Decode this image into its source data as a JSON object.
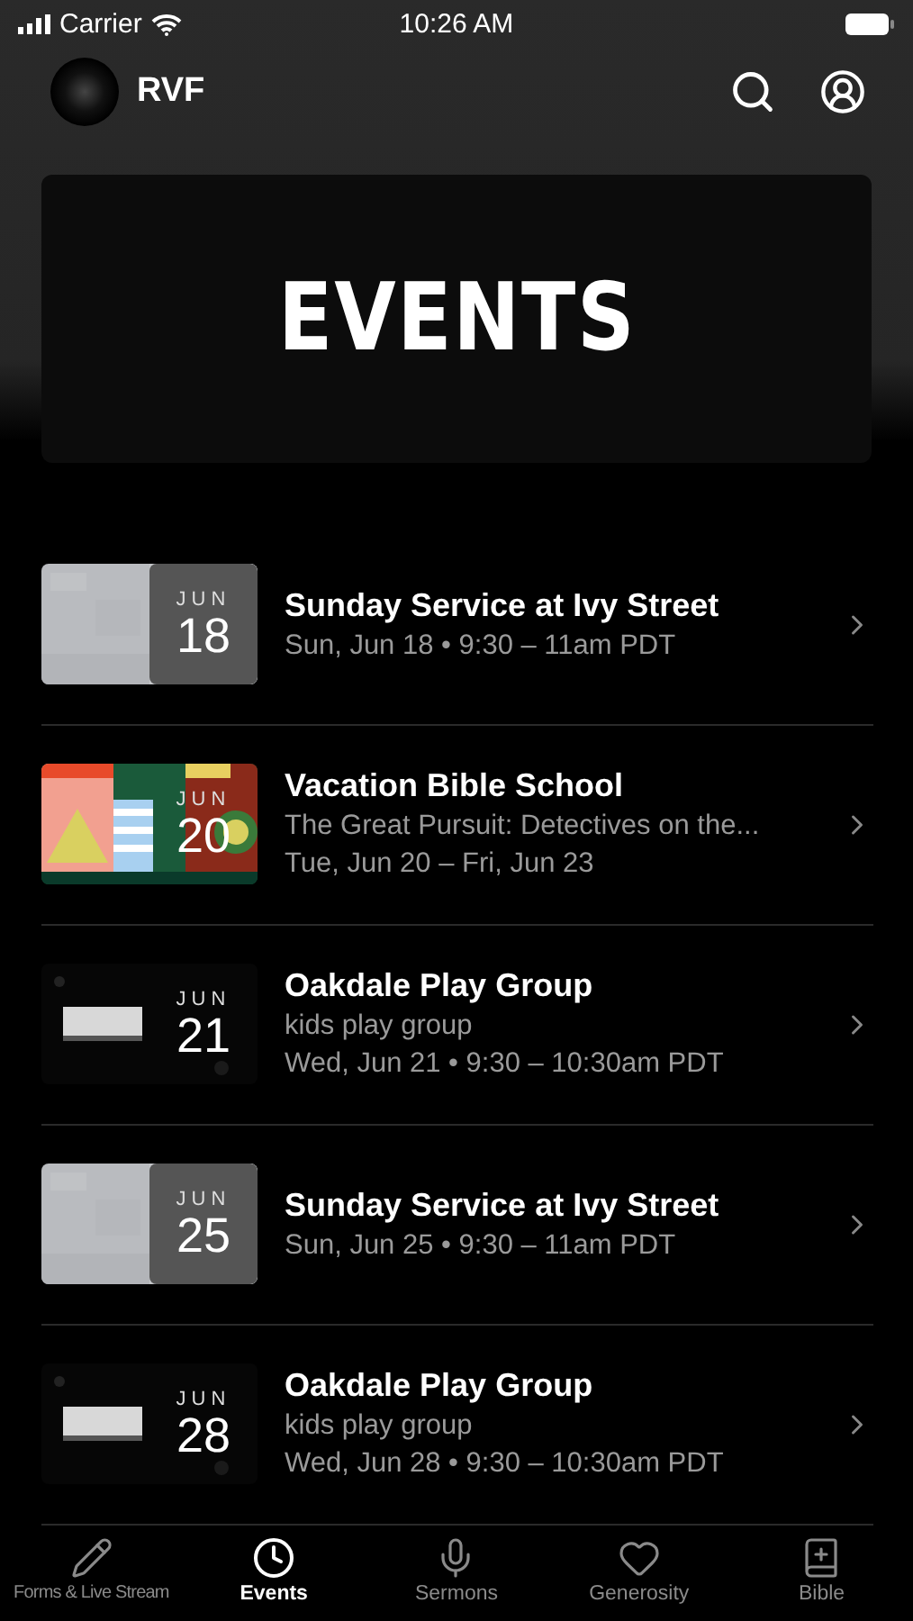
{
  "status_bar": {
    "carrier": "Carrier",
    "time": "10:26 AM"
  },
  "header": {
    "title": "RVF"
  },
  "hero": {
    "title": "EVENTS"
  },
  "events": [
    {
      "kind": "gray",
      "month": "JUN",
      "day": "18",
      "title": "Sunday Service at Ivy Street",
      "lines": [
        "Sun, Jun 18 • 9:30 – 11am PDT"
      ]
    },
    {
      "kind": "poster",
      "month": "JUN",
      "day": "20",
      "title": "Vacation Bible School",
      "lines": [
        "The Great Pursuit: Detectives on the...",
        "Tue, Jun 20 – Fri, Jun 23"
      ]
    },
    {
      "kind": "dark",
      "month": "JUN",
      "day": "21",
      "title": "Oakdale Play Group",
      "lines": [
        "kids play group",
        "Wed, Jun 21 • 9:30 – 10:30am PDT"
      ]
    },
    {
      "kind": "gray",
      "month": "JUN",
      "day": "25",
      "title": "Sunday Service at Ivy Street",
      "lines": [
        "Sun, Jun 25 • 9:30 – 11am PDT"
      ]
    },
    {
      "kind": "dark",
      "month": "JUN",
      "day": "28",
      "title": "Oakdale Play Group",
      "lines": [
        "kids play group",
        "Wed, Jun 28 • 9:30 – 10:30am PDT"
      ]
    }
  ],
  "tabs": [
    {
      "label": "Forms & Live Stream",
      "selected": false
    },
    {
      "label": "Events",
      "selected": true
    },
    {
      "label": "Sermons",
      "selected": false
    },
    {
      "label": "Generosity",
      "selected": false
    },
    {
      "label": "Bible",
      "selected": false
    }
  ]
}
